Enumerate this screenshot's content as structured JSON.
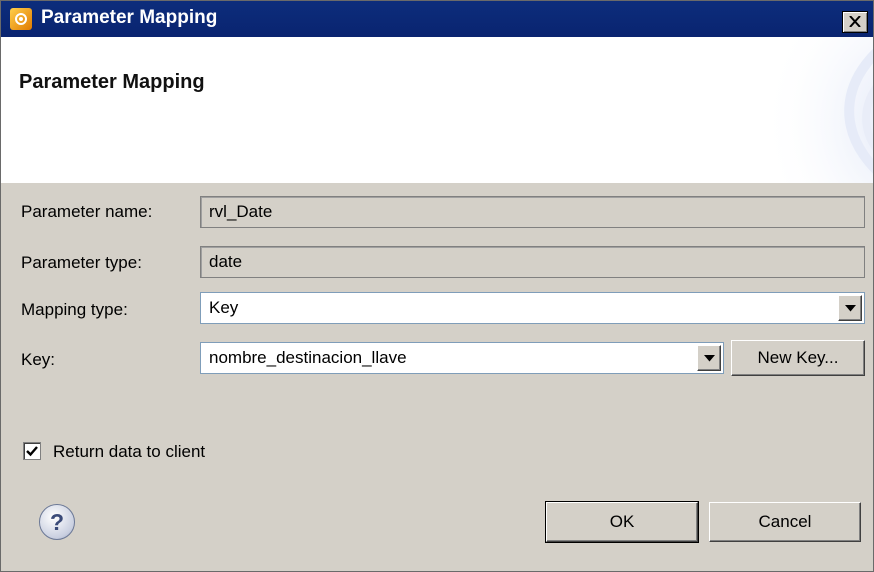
{
  "window": {
    "title": "Parameter Mapping",
    "close_label": "✕"
  },
  "banner": {
    "title": "Parameter Mapping"
  },
  "form": {
    "parameter_name": {
      "label": "Parameter name:",
      "value": "rvl_Date"
    },
    "parameter_type": {
      "label": "Parameter type:",
      "value": "date"
    },
    "mapping_type": {
      "label": "Mapping type:",
      "value": "Key"
    },
    "key": {
      "label": "Key:",
      "value": "nombre_destinacion_llave"
    },
    "new_key_button": "New Key...",
    "return_data": {
      "label": "Return data to client",
      "checked": true
    }
  },
  "footer": {
    "help_symbol": "?",
    "ok_label": "OK",
    "cancel_label": "Cancel"
  },
  "icons": [
    "app-icon",
    "close-icon",
    "help-icon",
    "dropdown-arrow-icon",
    "checkmark-icon"
  ]
}
